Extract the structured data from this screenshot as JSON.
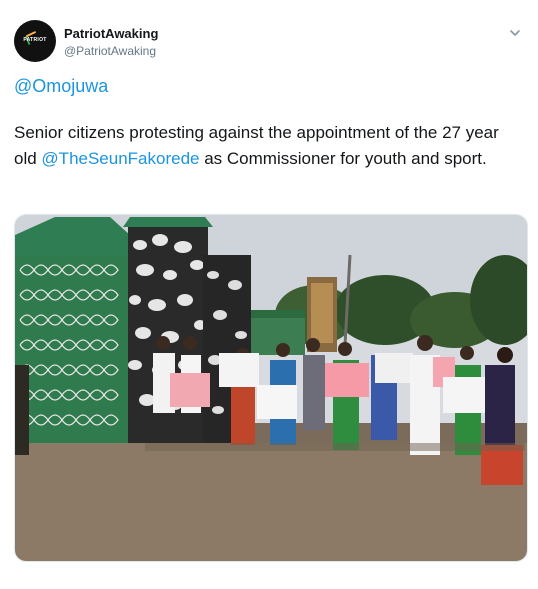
{
  "author": {
    "display_name": "PatriotAwaking",
    "handle": "@PatriotAwaking",
    "avatar_text": "PATRIOT",
    "avatar_icon": "logo-icon"
  },
  "menu_icon": "chevron-down-icon",
  "reply_to": "@Omojuwa",
  "tweet": {
    "text_before": "Senior citizens protesting against the appointment of the 27 year old ",
    "mention": "@TheSeunFakorede",
    "text_after": " as Commissioner for youth and sport."
  },
  "media": {
    "type": "photo",
    "icon": "photo"
  },
  "colors": {
    "link": "#1b95e0",
    "text": "#14171a",
    "secondary": "#657786"
  }
}
